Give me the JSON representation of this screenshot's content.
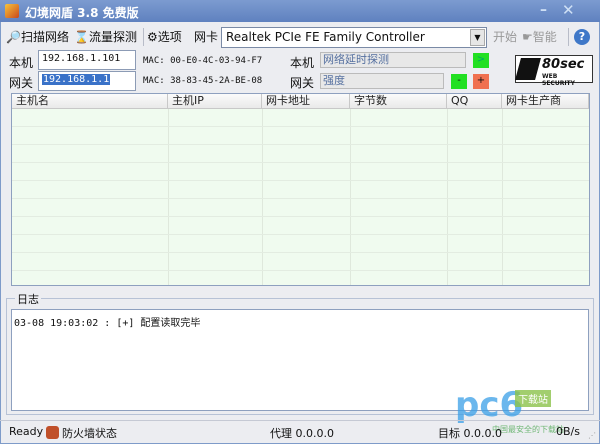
{
  "window": {
    "title": "幻境网盾 3.8 免费版",
    "minimize": "–",
    "close": "✕"
  },
  "toolbar": {
    "scan": "扫描网络",
    "flow": "流量探测",
    "options": "选项",
    "nic_label": "网卡",
    "nic_value": "Realtek PCIe FE Family Controller",
    "start": "开始",
    "smart": "智能",
    "help": "?"
  },
  "local": {
    "label": "本机",
    "ip": "192.168.1.101",
    "mac": "MAC: 00-E0-4C-03-94-F7"
  },
  "gateway": {
    "label": "网关",
    "ip": "192.168.1.1",
    "mac": "MAC: 38-83-45-2A-BE-08"
  },
  "probe": {
    "label": "本机",
    "value": "网络延时探测",
    "go": ">"
  },
  "strength": {
    "label": "网关",
    "value": "强度",
    "minus": "-",
    "plus": "+"
  },
  "logo": {
    "text": "80sec",
    "sub": "WEB SECURITY"
  },
  "table": {
    "columns": [
      "主机名",
      "主机IP",
      "网卡地址",
      "字节数",
      "QQ",
      "网卡生产商"
    ],
    "rows": []
  },
  "log": {
    "title": "日志",
    "lines": [
      "03-08 19:03:02 : [+] 配置读取完毕"
    ]
  },
  "status": {
    "ready": "Ready",
    "firewall": "防火墙状态",
    "proxy": "代理 0.0.0.0",
    "target": "目标 0.0.0.0",
    "speed": "0B/s"
  },
  "watermark": {
    "brand": "pc6",
    "badge": "下载站",
    "slogan": "中国最安全的下载站"
  }
}
